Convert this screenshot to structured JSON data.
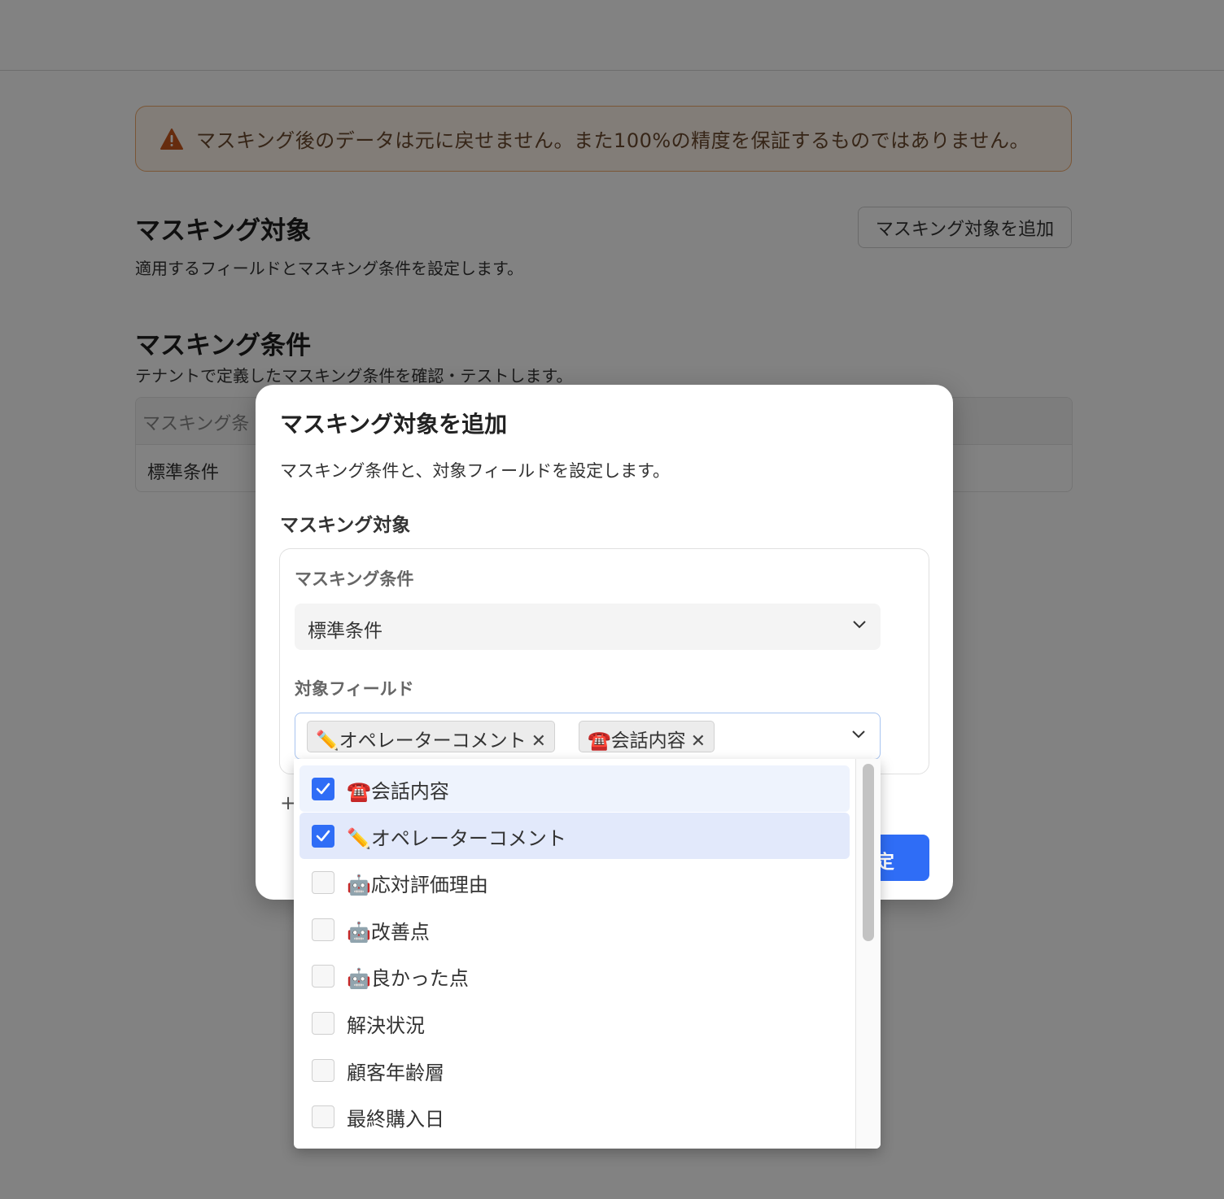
{
  "alert": {
    "text": "マスキング後のデータは元に戻せません。また100%の精度を保証するものではありません。",
    "icon": "warning-icon"
  },
  "targets_section": {
    "title": "マスキング対象",
    "description": "適用するフィールドとマスキング条件を設定します。",
    "add_button": "マスキング対象を追加"
  },
  "conditions_section": {
    "title": "マスキング条件",
    "description": "テナントで定義したマスキング条件を確認・テストします。",
    "table_header": "マスキング条",
    "table_row": "標準条件"
  },
  "modal": {
    "title": "マスキング対象を追加",
    "description": "マスキング条件と、対象フィールドを設定します。",
    "subheading": "マスキング対象",
    "condition_label": "マスキング条件",
    "condition_value": "標準条件",
    "fields_label": "対象フィールド",
    "selected_tags": [
      "✏️オペレーターコメント",
      "☎️会話内容"
    ],
    "add_symbol": "+",
    "primary_button": "定"
  },
  "dropdown": {
    "options": [
      {
        "label": "☎️会話内容",
        "checked": true
      },
      {
        "label": "✏️オペレーターコメント",
        "checked": true
      },
      {
        "label": "🤖応対評価理由",
        "checked": false
      },
      {
        "label": "🤖改善点",
        "checked": false
      },
      {
        "label": "🤖良かった点",
        "checked": false
      },
      {
        "label": "解決状況",
        "checked": false
      },
      {
        "label": "顧客年齢層",
        "checked": false
      },
      {
        "label": "最終購入日",
        "checked": false
      }
    ]
  },
  "colors": {
    "primary": "#2f6df6",
    "warning": "#d9631e"
  }
}
